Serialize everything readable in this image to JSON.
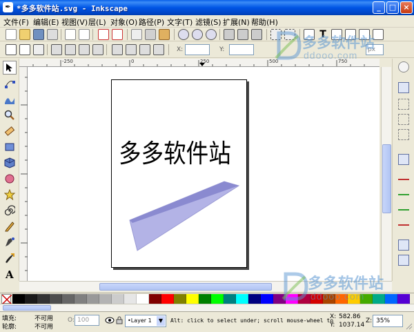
{
  "window": {
    "title": "*多多软件站.svg - Inkscape",
    "min_label": "_",
    "max_label": "□",
    "close_label": "×"
  },
  "menu": [
    {
      "label": "文件(F)"
    },
    {
      "label": "编辑(E)"
    },
    {
      "label": "视图(V)"
    },
    {
      "label": "层(L)"
    },
    {
      "label": "对象(O)"
    },
    {
      "label": "路径(P)"
    },
    {
      "label": "文字(T)"
    },
    {
      "label": "滤镜(S)"
    },
    {
      "label": "扩展(N)"
    },
    {
      "label": "帮助(H)"
    }
  ],
  "tool_controls": {
    "x_label": "X:",
    "y_label": "Y:",
    "unit": "px"
  },
  "ruler": {
    "top_ticks": [
      "-250",
      "0",
      "250",
      "500",
      "750"
    ]
  },
  "canvas": {
    "text": "多多软件站",
    "polygon_color": "#b3b3e6",
    "polygon_edge": "#8080c0"
  },
  "palette": [
    "#000000",
    "#1a1a1a",
    "#333333",
    "#4d4d4d",
    "#666666",
    "#808080",
    "#999999",
    "#b3b3b3",
    "#cccccc",
    "#e6e6e6",
    "#ffffff",
    "#800000",
    "#ff0000",
    "#808000",
    "#ffff00",
    "#008000",
    "#00ff00",
    "#008080",
    "#00ffff",
    "#000080",
    "#0000ff",
    "#800080",
    "#ff00ff",
    "#b00040",
    "#d40000",
    "#aa4400",
    "#ff6600",
    "#ffcc00",
    "#44aa00",
    "#00aa88",
    "#0066ff",
    "#5500d4"
  ],
  "status": {
    "fill_label": "填充:",
    "fill_value": "不可用",
    "stroke_label": "轮廓:",
    "stroke_value": "不可用",
    "opacity_label": "O:",
    "opacity_value": "100",
    "layer": "•Layer 1",
    "message": "Alt: click to select under; scroll mouse-wheel to",
    "x_label": "X:",
    "x_value": "582.86",
    "y_label": "Y:",
    "y_value": "1037.14",
    "zoom_label": "Z:",
    "zoom_value": "35%"
  },
  "watermark": {
    "brand": "多多软件站",
    "domain": "ddooo.com",
    "logo_letter": "D",
    "color": "#5a96d2"
  }
}
